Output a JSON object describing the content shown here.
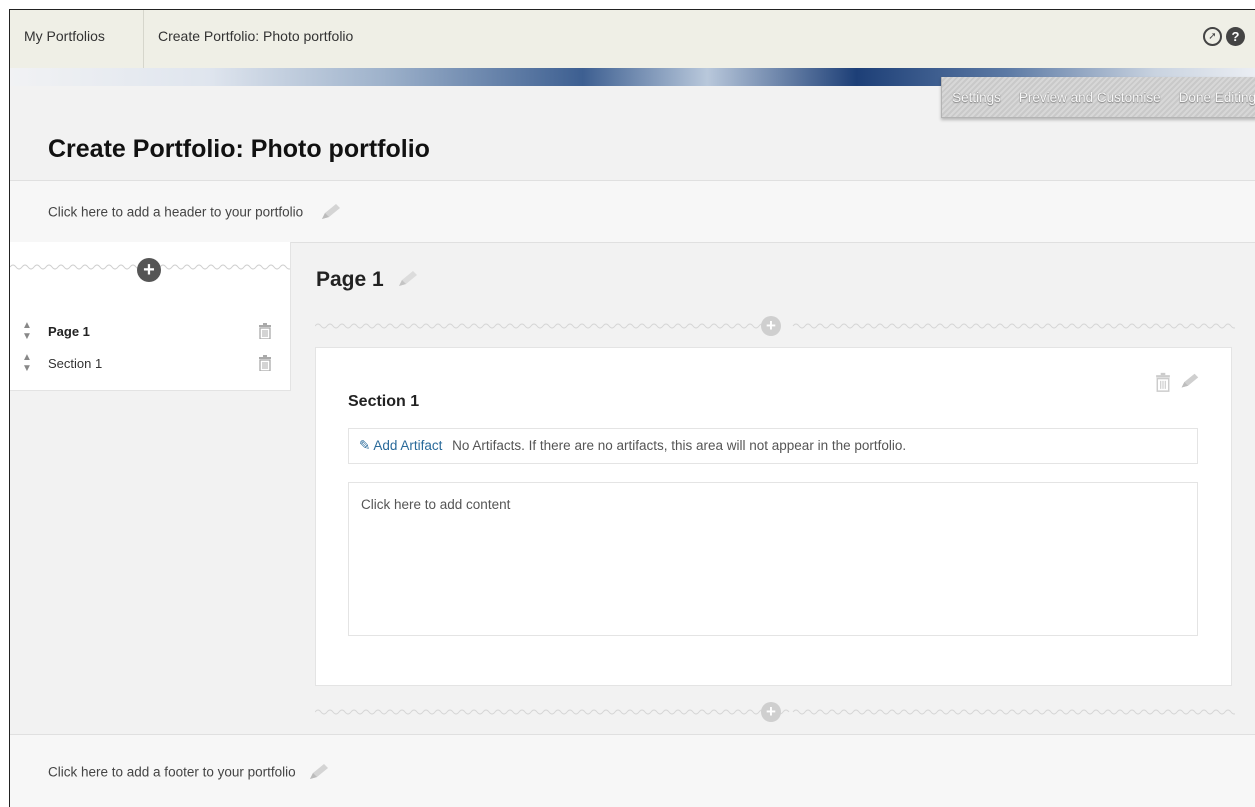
{
  "breadcrumb": {
    "items": [
      "My Portfolios",
      "Create Portfolio: Photo portfolio"
    ]
  },
  "icons": {
    "compass": "compass-icon",
    "help": "help-icon",
    "help_glyph": "?"
  },
  "actions": [
    "Settings",
    "Preview and Customise",
    "Done Editing"
  ],
  "page_title": "Create Portfolio: Photo portfolio",
  "header_hint": "Click here to add a header to your portfolio",
  "nav": {
    "items": [
      {
        "label": "Page 1"
      },
      {
        "label": "Section 1"
      }
    ]
  },
  "page": {
    "heading": "Page 1",
    "section": {
      "title": "Section 1",
      "add_artifact": "Add Artifact",
      "no_artifacts": "No Artifacts. If there are no artifacts, this area will not appear in the portfolio.",
      "content_hint": "Click here to add content"
    }
  },
  "footer_hint": "Click here to add a footer to your portfolio",
  "colors": {
    "link": "#2a6a9a",
    "plus_dark": "#555555",
    "plus_light": "#cfcfcf"
  }
}
